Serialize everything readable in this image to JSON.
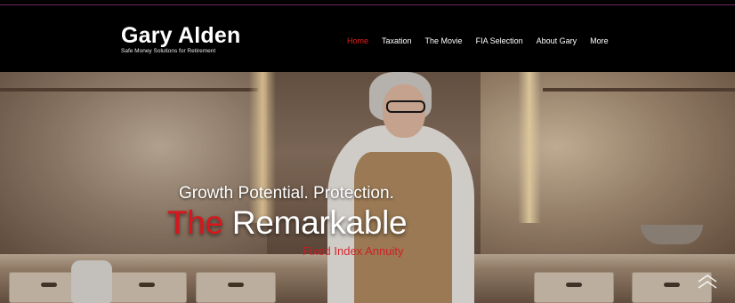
{
  "brand": {
    "name": "Gary Alden",
    "tagline": "Safe Money Solutions for Retirement"
  },
  "nav": {
    "items": [
      {
        "label": "Home",
        "active": true
      },
      {
        "label": "Taxation",
        "active": false
      },
      {
        "label": "The Movie",
        "active": false
      },
      {
        "label": "FIA Selection",
        "active": false
      },
      {
        "label": "About Gary",
        "active": false
      },
      {
        "label": "More",
        "active": false
      }
    ]
  },
  "hero": {
    "headline": "Growth Potential. Protection.",
    "big_prefix": "The",
    "big_word": "Remarkable",
    "subline": "Fixed Index Annuity"
  },
  "colors": {
    "accent_red": "#d8161c",
    "header_bg": "#000000",
    "nav_active": "#e0201e"
  },
  "icons": {
    "scroll_top": "double-chevron-up-icon"
  }
}
